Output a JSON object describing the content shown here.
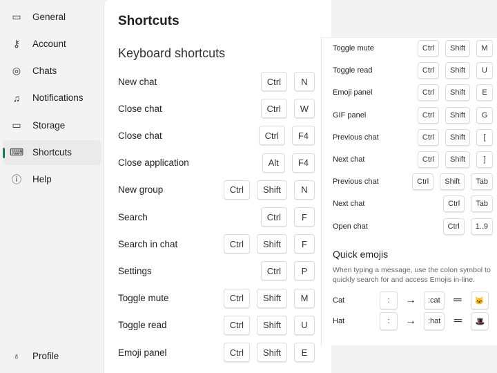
{
  "sidebar": {
    "items": [
      {
        "label": "General",
        "icon": "laptop-icon",
        "glyph": "▭"
      },
      {
        "label": "Account",
        "icon": "key-icon",
        "glyph": "⚷"
      },
      {
        "label": "Chats",
        "icon": "chat-icon",
        "glyph": "◎"
      },
      {
        "label": "Notifications",
        "icon": "bell-icon",
        "glyph": "♫"
      },
      {
        "label": "Storage",
        "icon": "storage-icon",
        "glyph": "▭"
      },
      {
        "label": "Shortcuts",
        "icon": "keyboard-icon",
        "glyph": "⌨",
        "active": true
      },
      {
        "label": "Help",
        "icon": "info-icon",
        "glyph": "ⓘ"
      }
    ],
    "profile": {
      "label": "Profile",
      "icon": "person-icon",
      "glyph": "♁"
    }
  },
  "main": {
    "title": "Shortcuts",
    "section": "Keyboard shortcuts",
    "shortcuts": [
      {
        "label": "New chat",
        "keys": [
          "Ctrl",
          "N"
        ]
      },
      {
        "label": "Close chat",
        "keys": [
          "Ctrl",
          "W"
        ]
      },
      {
        "label": "Close chat",
        "keys": [
          "Ctrl",
          "F4"
        ]
      },
      {
        "label": "Close application",
        "keys": [
          "Alt",
          "F4"
        ]
      },
      {
        "label": "New group",
        "keys": [
          "Ctrl",
          "Shift",
          "N"
        ]
      },
      {
        "label": "Search",
        "keys": [
          "Ctrl",
          "F"
        ]
      },
      {
        "label": "Search in chat",
        "keys": [
          "Ctrl",
          "Shift",
          "F"
        ]
      },
      {
        "label": "Settings",
        "keys": [
          "Ctrl",
          "P"
        ]
      },
      {
        "label": "Toggle mute",
        "keys": [
          "Ctrl",
          "Shift",
          "M"
        ]
      },
      {
        "label": "Toggle read",
        "keys": [
          "Ctrl",
          "Shift",
          "U"
        ]
      },
      {
        "label": "Emoji panel",
        "keys": [
          "Ctrl",
          "Shift",
          "E"
        ]
      }
    ]
  },
  "panel": {
    "shortcuts": [
      {
        "label": "Toggle mute",
        "keys": [
          "Ctrl",
          "Shift",
          "M"
        ]
      },
      {
        "label": "Toggle read",
        "keys": [
          "Ctrl",
          "Shift",
          "U"
        ]
      },
      {
        "label": "Emoji panel",
        "keys": [
          "Ctrl",
          "Shift",
          "E"
        ]
      },
      {
        "label": "GIF panel",
        "keys": [
          "Ctrl",
          "Shift",
          "G"
        ]
      },
      {
        "label": "Previous chat",
        "keys": [
          "Ctrl",
          "Shift",
          "["
        ]
      },
      {
        "label": "Next chat",
        "keys": [
          "Ctrl",
          "Shift",
          "]"
        ]
      },
      {
        "label": "Previous chat",
        "keys": [
          "Ctrl",
          "Shift",
          "Tab"
        ]
      },
      {
        "label": "Next chat",
        "keys": [
          "Ctrl",
          "Tab"
        ]
      },
      {
        "label": "Open chat",
        "keys": [
          "Ctrl",
          "1..9"
        ]
      }
    ],
    "quick_emojis": {
      "title": "Quick emojis",
      "description": "When typing a message, use the colon symbol to quickly search for and access Emojis in-line.",
      "items": [
        {
          "label": "Cat",
          "colon": ":",
          "arrow": "→",
          "code": ":cat",
          "equals": "═",
          "emoji": "🐱"
        },
        {
          "label": "Hat",
          "colon": ":",
          "arrow": "→",
          "code": ":hat",
          "equals": "═",
          "emoji": "🎩"
        }
      ]
    }
  }
}
